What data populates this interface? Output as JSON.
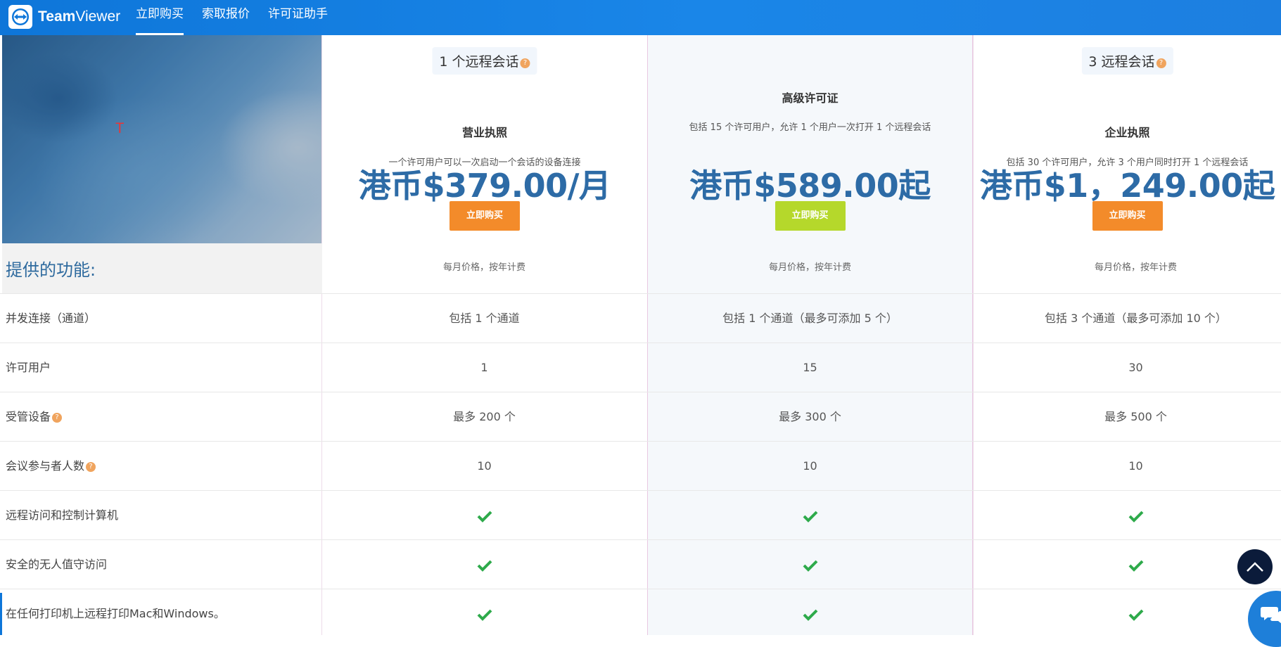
{
  "nav": {
    "brand_bold": "Team",
    "brand_light": "Viewer",
    "items": [
      "立即购买",
      "索取报价",
      "许可证助手"
    ]
  },
  "plans": [
    {
      "tag": "1 个远程会话",
      "name": "营业执照",
      "desc": "一个许可用户可以一次启动一个会话的设备连接",
      "price": "港币$379.00/月",
      "button": "立即购买",
      "button_color": "#f38b2a"
    },
    {
      "tag": "",
      "name": "高级许可证",
      "desc": "包括 15 个许可用户，允许 1 个用户一次打开 1 个远程会话",
      "price": "港币$589.00起",
      "button": "立即购买",
      "button_color": "#b5d82b"
    },
    {
      "tag": "3 远程会话",
      "name": "企业执照",
      "desc": "包括 30 个许可用户，允许 3 个用户同时打开 1 个远程会话",
      "price": "港币$1，249.00起",
      "button": "立即购买",
      "button_color": "#f38b2a"
    }
  ],
  "features_title": "提供的功能:",
  "billing_note": [
    "每月价格，按年计费",
    "每月价格，按年计费",
    "每月价格，按年计费"
  ],
  "rows": [
    {
      "label": "并发连接（通道）",
      "values": [
        "包括 1 个通道",
        "包括 1 个通道（最多可添加 5 个）",
        "包括 3 个通道（最多可添加 10 个）"
      ]
    },
    {
      "label": "许可用户",
      "values": [
        "1",
        "15",
        "30"
      ]
    },
    {
      "label": "受管设备",
      "help": true,
      "values": [
        "最多 200 个",
        "最多 300 个",
        "最多 500 个"
      ]
    },
    {
      "label": "会议参与者人数",
      "help": true,
      "values": [
        "10",
        "10",
        "10"
      ]
    },
    {
      "label": "远程访问和控制计算机",
      "check": true
    },
    {
      "label": "安全的无人值守访问",
      "check": true
    },
    {
      "label": "在任何打印机上远程打印Mac和Windows。",
      "check": true
    }
  ],
  "colors": {
    "nav_bg": "#1a86e8",
    "price": "#2d6ba6",
    "check": "#2eaa4b",
    "features_title": "#2e6a9e"
  },
  "icons": [
    "teamviewer-logo-icon",
    "help-icon",
    "check-icon",
    "chevron-up-icon",
    "chat-icon"
  ]
}
